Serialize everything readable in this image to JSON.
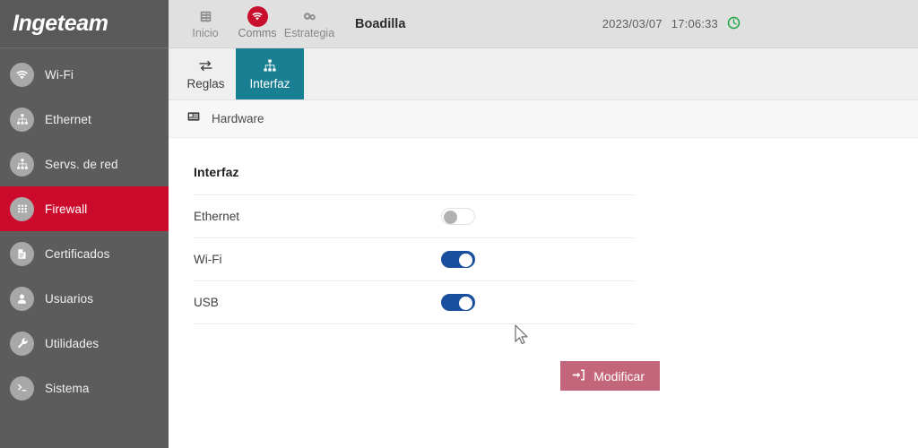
{
  "brand": {
    "logo_text": "Ingeteam"
  },
  "sidebar": {
    "items": [
      {
        "label": "Wi-Fi",
        "icon": "wifi-icon",
        "active": false
      },
      {
        "label": "Ethernet",
        "icon": "sitemap-icon",
        "active": false
      },
      {
        "label": "Servs. de red",
        "icon": "sitemap-icon",
        "active": false
      },
      {
        "label": "Firewall",
        "icon": "grid-icon",
        "active": true
      },
      {
        "label": "Certificados",
        "icon": "certificate-icon",
        "active": false
      },
      {
        "label": "Usuarios",
        "icon": "user-icon",
        "active": false
      },
      {
        "label": "Utilidades",
        "icon": "wrench-icon",
        "active": false
      },
      {
        "label": "Sistema",
        "icon": "terminal-icon",
        "active": false
      }
    ]
  },
  "topbar": {
    "nav": [
      {
        "label": "Inicio",
        "icon": "server-icon",
        "active": false
      },
      {
        "label": "Comms",
        "icon": "wifi-icon",
        "active": true
      },
      {
        "label": "Estrategia",
        "icon": "cogs-icon",
        "active": false
      }
    ],
    "site_title": "Boadilla",
    "date": "2023/03/07",
    "time": "17:06:33",
    "clock_icon": "clock-icon"
  },
  "tabs": [
    {
      "label": "Reglas",
      "icon": "exchange-icon",
      "active": false
    },
    {
      "label": "Interfaz",
      "icon": "sitemap-icon",
      "active": true
    }
  ],
  "breadcrumb": {
    "label": "Hardware",
    "icon": "list-icon"
  },
  "panel": {
    "title": "Interfaz",
    "rows": [
      {
        "label": "Ethernet",
        "state": "off"
      },
      {
        "label": "Wi-Fi",
        "state": "on"
      },
      {
        "label": "USB",
        "state": "on"
      }
    ]
  },
  "actions": {
    "modify_label": "Modificar",
    "modify_icon": "sign-in-icon"
  },
  "colors": {
    "sidebar_bg": "#5c5c5c",
    "active_red": "#cb0a2c",
    "tab_teal": "#197f92",
    "toggle_on_blue": "#1a4f9e",
    "button_rose": "#c4667b",
    "clock_green": "#19a642"
  }
}
